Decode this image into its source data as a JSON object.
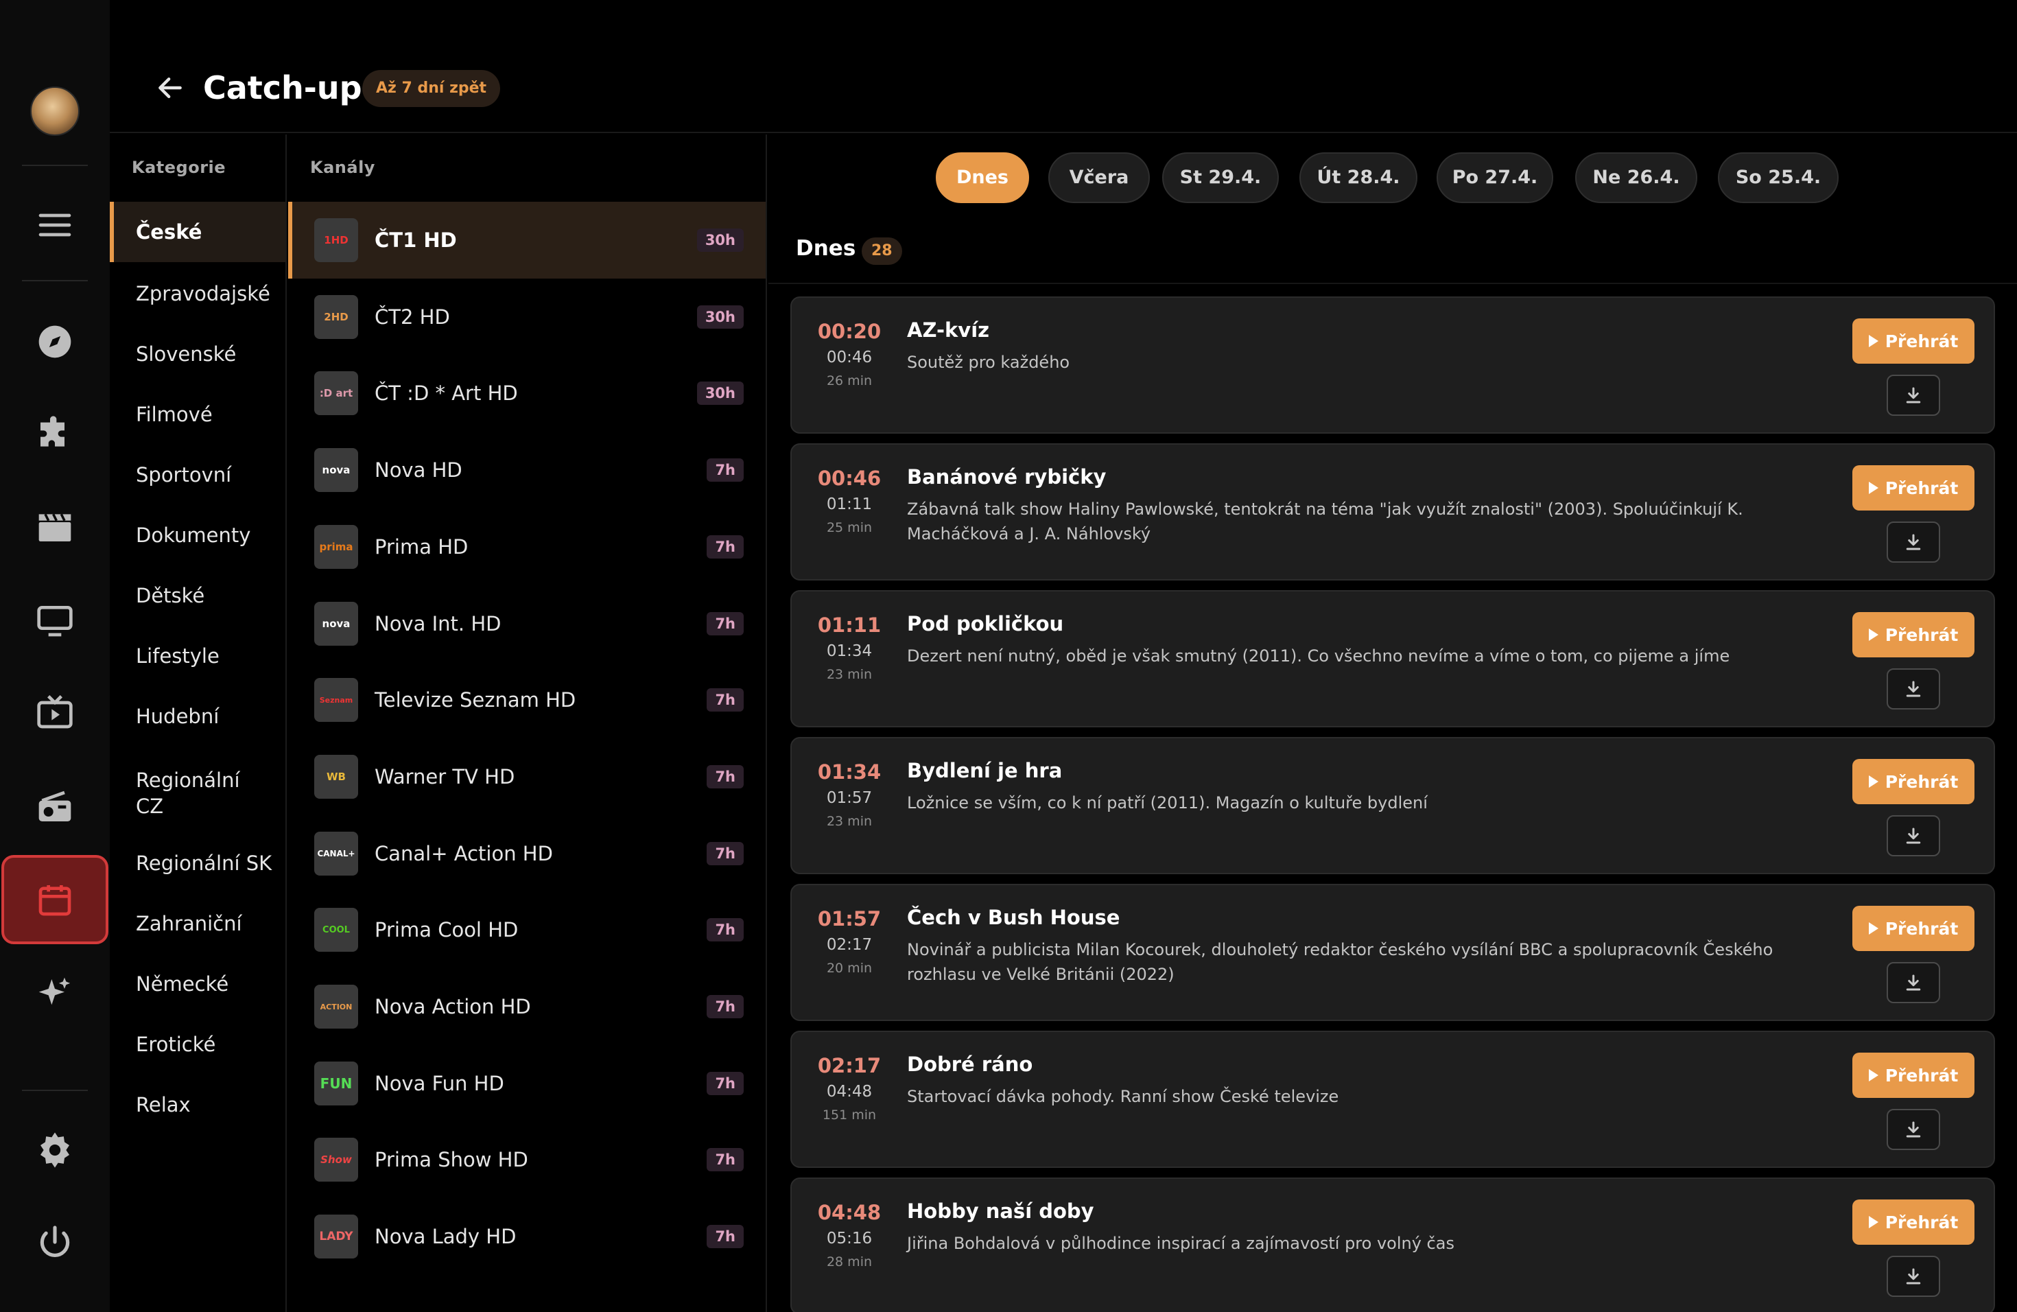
{
  "header": {
    "title": "Catch-up",
    "badge": "Až 7 dní zpět"
  },
  "categories": {
    "heading": "Kategorie",
    "items": [
      "České",
      "Zpravodajské",
      "Slovenské",
      "Filmové",
      "Sportovní",
      "Dokumenty",
      "Dětské",
      "Lifestyle",
      "Hudební",
      "Regionální CZ",
      "Regionální SK",
      "Zahraniční",
      "Německé",
      "Erotické",
      "Relax"
    ],
    "active_index": 0
  },
  "channels": {
    "heading": "Kanály",
    "items": [
      {
        "name": "ČT1 HD",
        "hours": "30h",
        "logo": "1HD"
      },
      {
        "name": "ČT2 HD",
        "hours": "30h",
        "logo": "2HD"
      },
      {
        "name": "ČT :D * Art HD",
        "hours": "30h",
        "logo": ":D art"
      },
      {
        "name": "Nova HD",
        "hours": "7h",
        "logo": "nova"
      },
      {
        "name": "Prima HD",
        "hours": "7h",
        "logo": "prima"
      },
      {
        "name": "Nova Int. HD",
        "hours": "7h",
        "logo": "nova"
      },
      {
        "name": "Televize Seznam HD",
        "hours": "7h",
        "logo": "Seznam"
      },
      {
        "name": "Warner TV HD",
        "hours": "7h",
        "logo": "WB"
      },
      {
        "name": "Canal+ Action HD",
        "hours": "7h",
        "logo": "CANAL+"
      },
      {
        "name": "Prima Cool HD",
        "hours": "7h",
        "logo": "COOL"
      },
      {
        "name": "Nova Action HD",
        "hours": "7h",
        "logo": "ACTION"
      },
      {
        "name": "Nova Fun HD",
        "hours": "7h",
        "logo": "FUN"
      },
      {
        "name": "Prima Show HD",
        "hours": "7h",
        "logo": "Show"
      },
      {
        "name": "Nova Lady HD",
        "hours": "7h",
        "logo": "LADY"
      }
    ],
    "active_index": 0
  },
  "days": {
    "items": [
      "Dnes",
      "Včera",
      "St 29.4.",
      "Út 28.4.",
      "Po 27.4.",
      "Ne 26.4.",
      "So 25.4."
    ],
    "active_index": 0
  },
  "list": {
    "heading": "Dnes",
    "count": "28",
    "play_label": "Přehrát"
  },
  "programs": [
    {
      "start": "00:20",
      "end": "00:46",
      "dur": "26 min",
      "title": "AZ-kvíz",
      "desc": "Soutěž pro každého"
    },
    {
      "start": "00:46",
      "end": "01:11",
      "dur": "25 min",
      "title": "Banánové rybičky",
      "desc": "Zábavná talk show Haliny Pawlowské, tentokrát na téma \"jak využít znalosti\" (2003). Spoluúčinkují K. Macháčková a J. A. Náhlovský"
    },
    {
      "start": "01:11",
      "end": "01:34",
      "dur": "23 min",
      "title": "Pod pokličkou",
      "desc": "Dezert není nutný, oběd je však smutný (2011). Co všechno nevíme a víme o tom, co pijeme a jíme"
    },
    {
      "start": "01:34",
      "end": "01:57",
      "dur": "23 min",
      "title": "Bydlení je hra",
      "desc": "Ložnice se vším, co k ní patří (2011). Magazín o kultuře bydlení"
    },
    {
      "start": "01:57",
      "end": "02:17",
      "dur": "20 min",
      "title": "Čech v Bush House",
      "desc": "Novinář a publicista Milan Kocourek, dlouholetý redaktor českého vysílání BBC a spolupracovník Českého rozhlasu ve Velké Británii (2022)"
    },
    {
      "start": "02:17",
      "end": "04:48",
      "dur": "151 min",
      "title": "Dobré ráno",
      "desc": "Startovací dávka pohody. Ranní show České televize"
    },
    {
      "start": "04:48",
      "end": "05:16",
      "dur": "28 min",
      "title": "Hobby naší doby",
      "desc": "Jiřina Bohdalová v půlhodince inspirací a zajímavostí pro volný čas"
    }
  ],
  "colors": {
    "accent": "#e89a4a",
    "active_rail": "#d33a3a",
    "time_start": "#e88a7a"
  },
  "rail_icons": [
    "menu-icon",
    "compass-icon",
    "puzzle-icon",
    "clapperboard-icon",
    "tv-icon",
    "play-tv-icon",
    "radio-icon",
    "calendar-icon",
    "sparkles-icon",
    "gear-icon",
    "power-icon"
  ]
}
